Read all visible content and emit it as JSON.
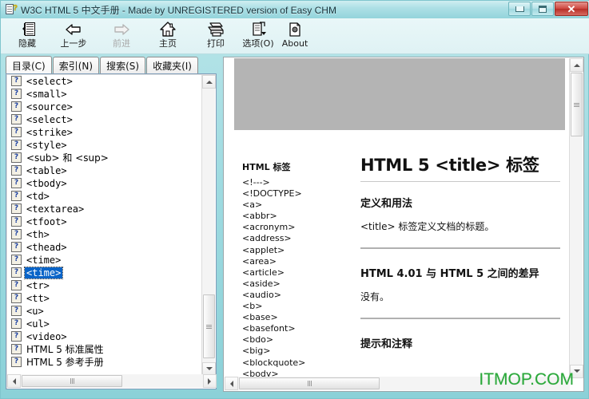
{
  "window": {
    "title": "W3C HTML 5 中文手册 - Made by UNREGISTERED version of Easy CHM",
    "icon": "chm-help-document-icon",
    "minimize_label": "—",
    "maximize_label": "□",
    "close_label": "✕"
  },
  "toolbar": {
    "items": [
      {
        "label": "隐藏",
        "icon": "hide-pane-icon",
        "disabled": false
      },
      {
        "label": "上一步",
        "icon": "back-arrow-icon",
        "disabled": false
      },
      {
        "label": "前进",
        "icon": "forward-arrow-icon",
        "disabled": true
      },
      {
        "label": "主页",
        "icon": "home-icon",
        "disabled": false
      },
      {
        "label": "打印",
        "icon": "printer-icon",
        "disabled": false
      },
      {
        "label": "选项(O)",
        "icon": "options-icon",
        "disabled": false
      },
      {
        "label": "About",
        "icon": "about-icon",
        "disabled": false
      }
    ]
  },
  "nav": {
    "tabs": [
      {
        "label": "目录(C)",
        "active": true
      },
      {
        "label": "索引(N)",
        "active": false
      },
      {
        "label": "搜索(S)",
        "active": false
      },
      {
        "label": "收藏夹(I)",
        "active": false
      }
    ],
    "tree_items": [
      {
        "label": "<select>",
        "selected": false,
        "cjk": false
      },
      {
        "label": "<small>",
        "selected": false,
        "cjk": false
      },
      {
        "label": "<source>",
        "selected": false,
        "cjk": false
      },
      {
        "label": "<select>",
        "selected": false,
        "cjk": false
      },
      {
        "label": "<strike>",
        "selected": false,
        "cjk": false
      },
      {
        "label": "<style>",
        "selected": false,
        "cjk": false
      },
      {
        "label": "<sub> 和 <sup>",
        "selected": false,
        "cjk": true
      },
      {
        "label": "<table>",
        "selected": false,
        "cjk": false
      },
      {
        "label": "<tbody>",
        "selected": false,
        "cjk": false
      },
      {
        "label": "<td>",
        "selected": false,
        "cjk": false
      },
      {
        "label": "<textarea>",
        "selected": false,
        "cjk": false
      },
      {
        "label": "<tfoot>",
        "selected": false,
        "cjk": false
      },
      {
        "label": "<th>",
        "selected": false,
        "cjk": false
      },
      {
        "label": "<thead>",
        "selected": false,
        "cjk": false
      },
      {
        "label": "<time>",
        "selected": false,
        "cjk": false
      },
      {
        "label": "<time>",
        "selected": true,
        "cjk": false
      },
      {
        "label": "<tr>",
        "selected": false,
        "cjk": false
      },
      {
        "label": "<tt>",
        "selected": false,
        "cjk": false
      },
      {
        "label": "<u>",
        "selected": false,
        "cjk": false
      },
      {
        "label": "<ul>",
        "selected": false,
        "cjk": false
      },
      {
        "label": "<video>",
        "selected": false,
        "cjk": false
      },
      {
        "label": "HTML 5 标准属性",
        "selected": false,
        "cjk": true
      },
      {
        "label": "HTML 5 参考手册",
        "selected": false,
        "cjk": true
      }
    ],
    "tree_icon_glyph": "?"
  },
  "content": {
    "tag_list_heading": "HTML 标签",
    "tag_list": [
      "<!--->",
      "<!DOCTYPE>",
      "<a>",
      "<abbr>",
      "<acronym>",
      "<address>",
      "<applet>",
      "<area>",
      "<article>",
      "<aside>",
      "<audio>",
      "<b>",
      "<base>",
      "<basefont>",
      "<bdo>",
      "<big>",
      "<blockquote>",
      "<body>"
    ],
    "page_title": "HTML 5 <title> 标签",
    "section1_heading": "定义和用法",
    "section1_body": "<title> 标签定义文档的标题。",
    "section2_heading": "HTML 4.01 与 HTML 5 之间的差异",
    "section2_body": "没有。",
    "section3_heading": "提示和注释",
    "watermark": "ITMOP.COM"
  },
  "colors": {
    "titlebar_accent": "#93d4db",
    "close_button": "#cf4a42",
    "selection": "#0a64c8",
    "watermark": "#2aa83a",
    "placeholder_block": "#b4b4b4"
  }
}
